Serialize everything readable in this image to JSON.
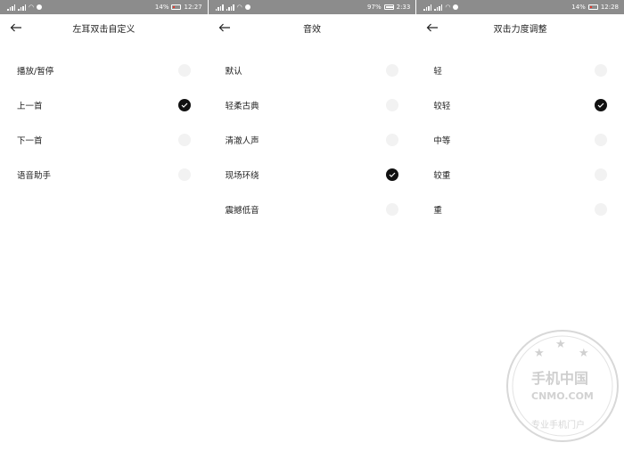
{
  "panels": [
    {
      "status": {
        "battery": "14%",
        "time": "12:27",
        "battery_low": true
      },
      "title": "左耳双击自定义",
      "items": [
        {
          "label": "播放/暂停",
          "checked": false
        },
        {
          "label": "上一首",
          "checked": true
        },
        {
          "label": "下一首",
          "checked": false
        },
        {
          "label": "语音助手",
          "checked": false
        }
      ]
    },
    {
      "status": {
        "battery": "97%",
        "time": "2:33",
        "battery_low": false
      },
      "title": "音效",
      "items": [
        {
          "label": "默认",
          "checked": false
        },
        {
          "label": "轻柔古典",
          "checked": false
        },
        {
          "label": "清澈人声",
          "checked": false
        },
        {
          "label": "现场环绕",
          "checked": true
        },
        {
          "label": "震撼低音",
          "checked": false
        }
      ]
    },
    {
      "status": {
        "battery": "14%",
        "time": "12:28",
        "battery_low": true
      },
      "title": "双击力度调整",
      "items": [
        {
          "label": "轻",
          "checked": false
        },
        {
          "label": "较轻",
          "checked": true
        },
        {
          "label": "中等",
          "checked": false
        },
        {
          "label": "较重",
          "checked": false
        },
        {
          "label": "重",
          "checked": false
        }
      ]
    }
  ],
  "watermark": {
    "brand": "手机中国",
    "site": "CNMO.COM",
    "slogan": "专业手机门户"
  },
  "colors": {
    "statusbar": "#8c8c8c",
    "checked": "#111111",
    "unchecked": "#f2f2f2"
  }
}
